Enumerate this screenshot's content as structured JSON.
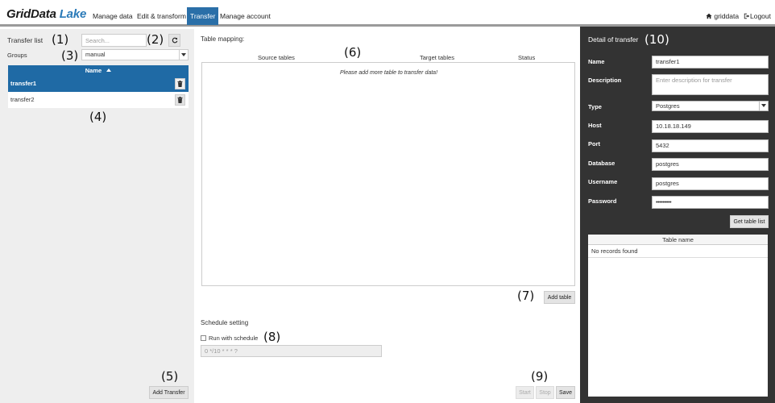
{
  "nav": {
    "brand_part1": "GridData",
    "brand_part2": "Lake",
    "items": [
      "Manage data",
      "Edit & transform",
      "Transfer",
      "Manage account"
    ],
    "user": "griddata",
    "logout": "Logout"
  },
  "left": {
    "title": "Transfer list",
    "search_placeholder": "Search...",
    "groups_label": "Groups",
    "groups_value": "manual",
    "column_name": "Name",
    "rows": [
      "transfer1",
      "transfer2"
    ],
    "add_transfer": "Add Transfer"
  },
  "center": {
    "mapping_title": "Table mapping:",
    "col_source": "Source tables",
    "col_target": "Target tables",
    "col_status": "Status",
    "empty_message": "Please add more table to transfer data!",
    "add_table": "Add table",
    "schedule_title": "Schedule setting",
    "run_with_schedule": "Run with schedule",
    "cron_value": "0 */10 * * * ?",
    "start": "Start",
    "stop": "Stop",
    "save": "Save"
  },
  "right": {
    "title": "Detail of transfer",
    "name_label": "Name",
    "name_value": "transfer1",
    "description_label": "Description",
    "description_placeholder": "Enter description for transfer",
    "type_label": "Type",
    "type_value": "Postgres",
    "host_label": "Host",
    "host_value": "10.18.18.149",
    "port_label": "Port",
    "port_value": "5432",
    "database_label": "Database",
    "database_value": "postgres",
    "username_label": "Username",
    "username_value": "postgres",
    "password_label": "Password",
    "password_value": "•••••••••",
    "get_table_list": "Get table list",
    "table_header": "Table name",
    "no_records": "No records found"
  },
  "annotations": [
    "(1)",
    "(2)",
    "(3)",
    "(4)",
    "(5)",
    "(6)",
    "(7)",
    "(8)",
    "(9)",
    "(10)"
  ],
  "colors": {
    "accent": "#1f6aa5",
    "right_panel_bg": "#333333",
    "left_panel_bg": "#eeeeee"
  }
}
